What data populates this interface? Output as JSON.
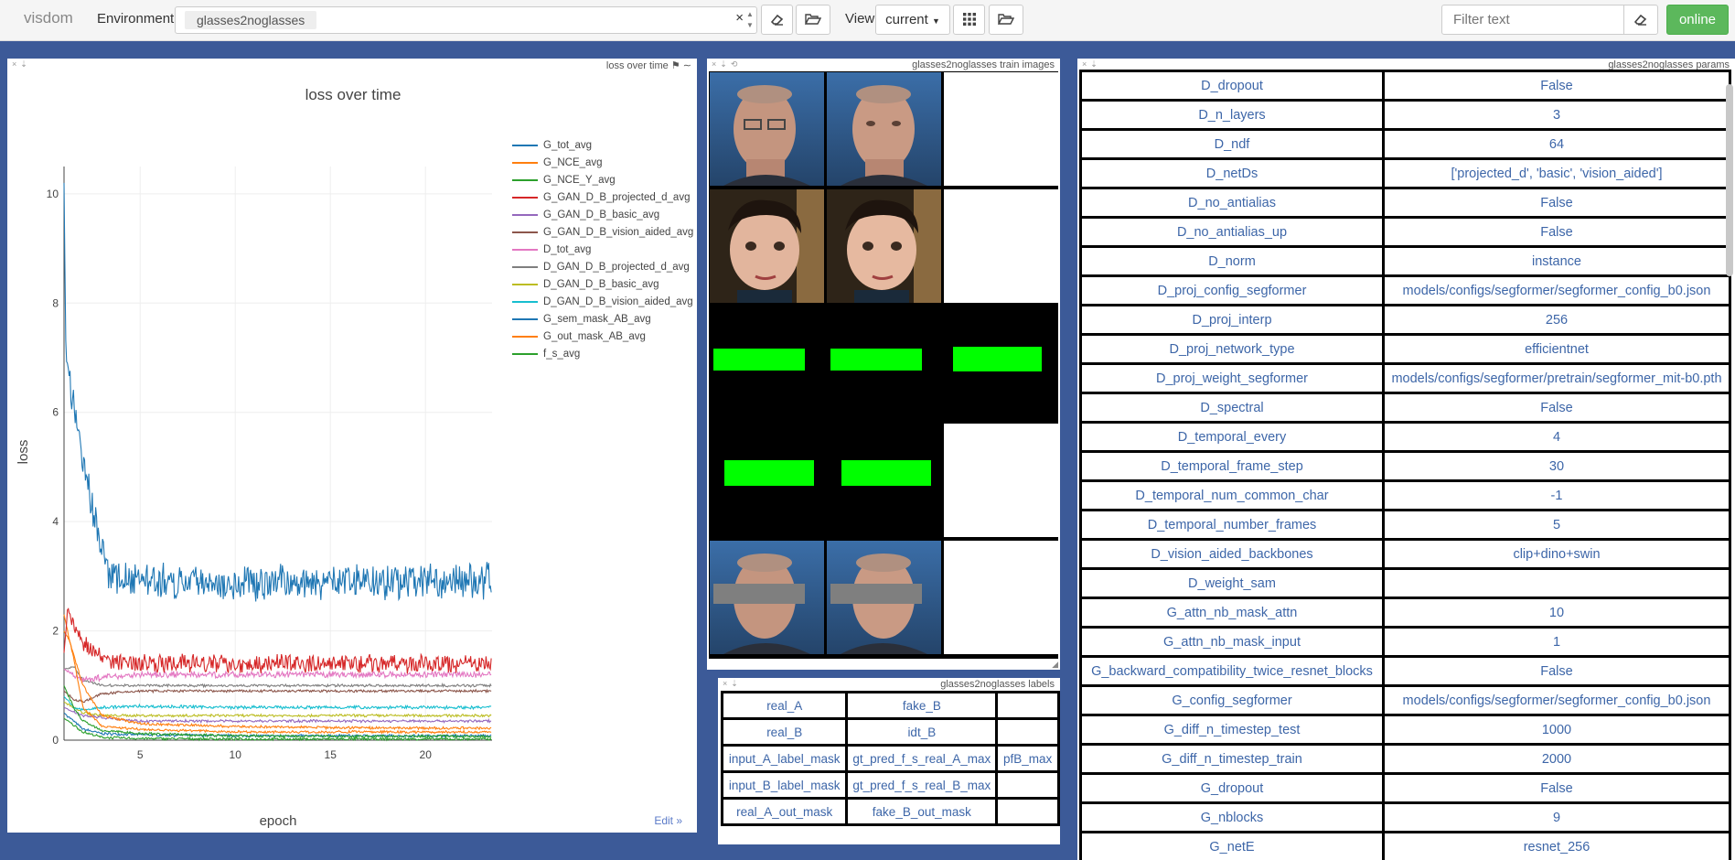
{
  "app": {
    "name": "visdom"
  },
  "toolbar": {
    "environment_label": "Environment",
    "environment_value": "glasses2noglasses",
    "clear_symbol": "×",
    "view_label": "View",
    "view_value": "current",
    "filter_placeholder": "Filter text",
    "status": "online"
  },
  "icons": [
    "eraser-icon",
    "folder-open-icon",
    "grid-icon",
    "folder-open-icon",
    "eraser-icon",
    "close-icon",
    "download-icon",
    "reset-icon",
    "tag-icon",
    "wave-icon",
    "resize-handle-icon"
  ],
  "colors": {
    "background": "#3c5a98",
    "link": "#3d66a8",
    "online": "#5cb85c"
  },
  "loss_pane": {
    "window_title": "loss over time",
    "edit_link": "Edit »"
  },
  "images_pane": {
    "window_title": "glasses2noglasses train images"
  },
  "labels_pane": {
    "window_title": "glasses2noglasses labels",
    "rows": [
      [
        "real_A",
        "fake_B",
        ""
      ],
      [
        "real_B",
        "idt_B",
        ""
      ],
      [
        "input_A_label_mask",
        "gt_pred_f_s_real_A_max",
        "pfB_max"
      ],
      [
        "input_B_label_mask",
        "gt_pred_f_s_real_B_max",
        ""
      ],
      [
        "real_A_out_mask",
        "fake_B_out_mask",
        ""
      ]
    ]
  },
  "params_pane": {
    "window_title": "glasses2noglasses params",
    "rows": [
      [
        "D_dropout",
        "False"
      ],
      [
        "D_n_layers",
        "3"
      ],
      [
        "D_ndf",
        "64"
      ],
      [
        "D_netDs",
        "['projected_d', 'basic', 'vision_aided']"
      ],
      [
        "D_no_antialias",
        "False"
      ],
      [
        "D_no_antialias_up",
        "False"
      ],
      [
        "D_norm",
        "instance"
      ],
      [
        "D_proj_config_segformer",
        "models/configs/segformer/segformer_config_b0.json"
      ],
      [
        "D_proj_interp",
        "256"
      ],
      [
        "D_proj_network_type",
        "efficientnet"
      ],
      [
        "D_proj_weight_segformer",
        "models/configs/segformer/pretrain/segformer_mit-b0.pth"
      ],
      [
        "D_spectral",
        "False"
      ],
      [
        "D_temporal_every",
        "4"
      ],
      [
        "D_temporal_frame_step",
        "30"
      ],
      [
        "D_temporal_num_common_char",
        "-1"
      ],
      [
        "D_temporal_number_frames",
        "5"
      ],
      [
        "D_vision_aided_backbones",
        "clip+dino+swin"
      ],
      [
        "D_weight_sam",
        ""
      ],
      [
        "G_attn_nb_mask_attn",
        "10"
      ],
      [
        "G_attn_nb_mask_input",
        "1"
      ],
      [
        "G_backward_compatibility_twice_resnet_blocks",
        "False"
      ],
      [
        "G_config_segformer",
        "models/configs/segformer/segformer_config_b0.json"
      ],
      [
        "G_diff_n_timestep_test",
        "1000"
      ],
      [
        "G_diff_n_timestep_train",
        "2000"
      ],
      [
        "G_dropout",
        "False"
      ],
      [
        "G_nblocks",
        "9"
      ],
      [
        "G_netE",
        "resnet_256"
      ]
    ]
  },
  "chart_data": {
    "type": "line",
    "title": "loss over time",
    "xlabel": "epoch",
    "ylabel": "loss",
    "xlim": [
      1,
      23.5
    ],
    "ylim": [
      0,
      10.5
    ],
    "xticks": [
      5,
      10,
      15,
      20
    ],
    "yticks": [
      0,
      2,
      4,
      6,
      8,
      10
    ],
    "grid": true,
    "legend_position": "right",
    "series": [
      {
        "name": "G_tot_avg",
        "color": "#1f77b4",
        "x": [
          1,
          1.1,
          1.3,
          1.6,
          2,
          2.5,
          3,
          3.5,
          5,
          10,
          15,
          20,
          23.5
        ],
        "y": [
          10.2,
          7.0,
          6.6,
          6.0,
          5.0,
          4.2,
          3.5,
          3.0,
          2.9,
          2.9,
          2.9,
          2.9,
          2.9
        ]
      },
      {
        "name": "G_NCE_avg",
        "color": "#ff7f0e",
        "x": [
          1,
          1.3,
          2,
          3,
          5,
          10,
          15,
          20,
          23.5
        ],
        "y": [
          2.0,
          1.8,
          1.0,
          0.45,
          0.3,
          0.25,
          0.23,
          0.22,
          0.22
        ]
      },
      {
        "name": "G_NCE_Y_avg",
        "color": "#2ca02c",
        "x": [
          1,
          1.5,
          2,
          3,
          5,
          10,
          15,
          20,
          23.5
        ],
        "y": [
          1.0,
          0.6,
          0.35,
          0.18,
          0.12,
          0.08,
          0.07,
          0.07,
          0.07
        ]
      },
      {
        "name": "G_GAN_D_B_projected_d_avg",
        "color": "#d62728",
        "x": [
          1,
          1.2,
          1.5,
          2,
          3,
          5,
          10,
          15,
          20,
          23.5
        ],
        "y": [
          1.6,
          2.4,
          2.1,
          1.8,
          1.5,
          1.4,
          1.4,
          1.4,
          1.4,
          1.4
        ]
      },
      {
        "name": "G_GAN_D_B_basic_avg",
        "color": "#9467bd",
        "x": [
          1,
          2,
          5,
          10,
          15,
          20,
          23.5
        ],
        "y": [
          0.6,
          0.45,
          0.35,
          0.35,
          0.35,
          0.35,
          0.35
        ]
      },
      {
        "name": "G_GAN_D_B_vision_aided_avg",
        "color": "#8c564b",
        "x": [
          1,
          1.5,
          2,
          3,
          5,
          10,
          15,
          20,
          23.5
        ],
        "y": [
          0.9,
          0.75,
          0.7,
          0.85,
          0.9,
          0.9,
          0.9,
          0.9,
          0.9
        ]
      },
      {
        "name": "D_tot_avg",
        "color": "#e377c2",
        "x": [
          1,
          1.5,
          2,
          3,
          5,
          10,
          15,
          20,
          23.5
        ],
        "y": [
          1.3,
          1.2,
          1.1,
          1.15,
          1.2,
          1.2,
          1.2,
          1.2,
          1.2
        ]
      },
      {
        "name": "D_GAN_D_B_projected_d_avg",
        "color": "#7f7f7f",
        "x": [
          1,
          1.5,
          2,
          3,
          5,
          10,
          15,
          20,
          23.5
        ],
        "y": [
          1.3,
          1.35,
          1.1,
          1.0,
          1.0,
          1.0,
          1.0,
          1.0,
          1.0
        ]
      },
      {
        "name": "D_GAN_D_B_basic_avg",
        "color": "#bcbd22",
        "x": [
          1,
          2,
          3,
          5,
          10,
          15,
          20,
          23.5
        ],
        "y": [
          0.7,
          0.5,
          0.45,
          0.45,
          0.45,
          0.45,
          0.45,
          0.45
        ]
      },
      {
        "name": "D_GAN_D_B_vision_aided_avg",
        "color": "#17becf",
        "x": [
          1,
          1.5,
          2,
          3,
          5,
          10,
          15,
          20,
          23.5
        ],
        "y": [
          0.8,
          0.6,
          0.55,
          0.6,
          0.62,
          0.6,
          0.6,
          0.6,
          0.6
        ]
      },
      {
        "name": "G_sem_mask_AB_avg",
        "color": "#1f77b4",
        "x": [
          1,
          2,
          3,
          5,
          10,
          15,
          20,
          23.5
        ],
        "y": [
          0.5,
          0.2,
          0.12,
          0.1,
          0.08,
          0.08,
          0.08,
          0.08
        ]
      },
      {
        "name": "G_out_mask_AB_avg",
        "color": "#ff7f0e",
        "x": [
          1,
          1.5,
          2,
          3,
          5,
          10,
          15,
          20,
          23.5
        ],
        "y": [
          2.3,
          1.5,
          0.6,
          0.25,
          0.2,
          0.15,
          0.15,
          0.15,
          0.15
        ]
      },
      {
        "name": "f_s_avg",
        "color": "#2ca02c",
        "x": [
          1,
          2,
          3,
          5,
          10,
          15,
          20,
          23.5
        ],
        "y": [
          0.4,
          0.15,
          0.05,
          0.03,
          0.02,
          0.02,
          0.02,
          0.02
        ]
      }
    ]
  }
}
